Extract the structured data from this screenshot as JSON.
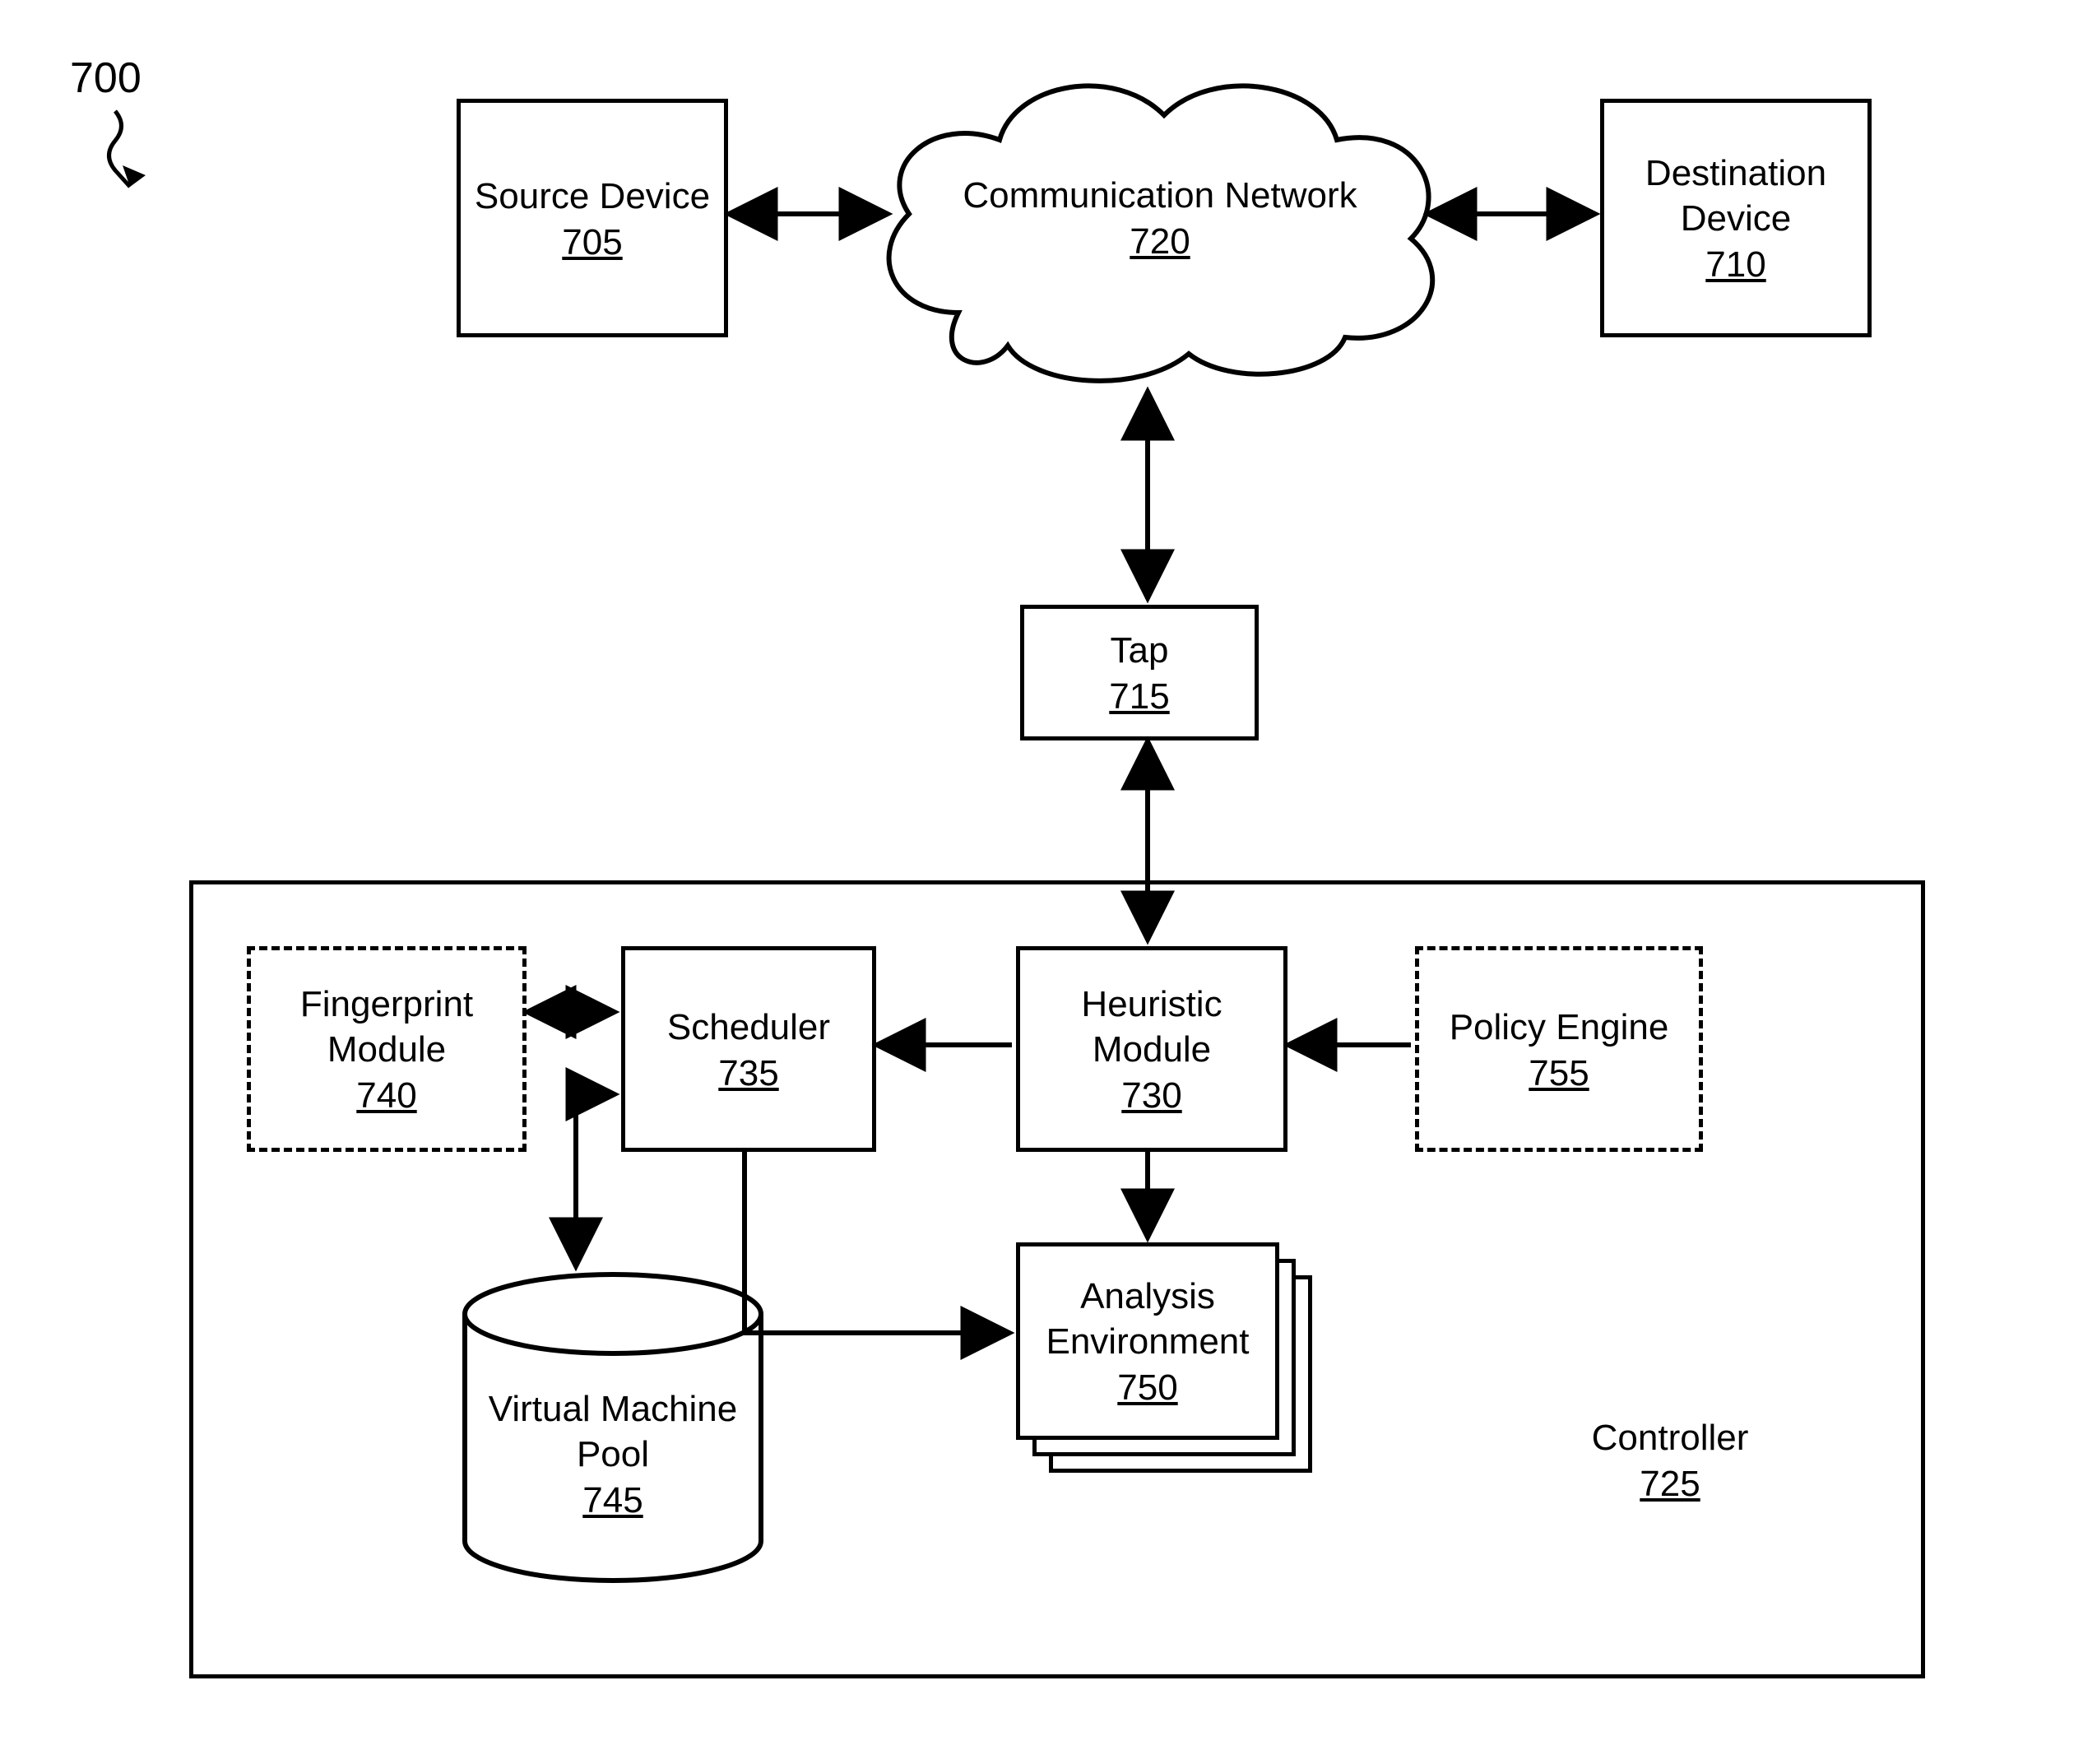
{
  "figure_ref": "700",
  "nodes": {
    "source": {
      "label": "Source Device",
      "num": "705"
    },
    "destination": {
      "label": "Destination Device",
      "num": "710"
    },
    "tap": {
      "label": "Tap",
      "num": "715"
    },
    "network": {
      "label": "Communication Network",
      "num": "720"
    },
    "controller": {
      "label": "Controller",
      "num": "725"
    },
    "heuristic": {
      "label": "Heuristic Module",
      "num": "730"
    },
    "scheduler": {
      "label": "Scheduler",
      "num": "735"
    },
    "fingerprint": {
      "label": "Fingerprint Module",
      "num": "740"
    },
    "vmpool": {
      "label": "Virtual Machine Pool",
      "num": "745"
    },
    "analysis": {
      "label": "Analysis Environment",
      "num": "750"
    },
    "policy": {
      "label": "Policy Engine",
      "num": "755"
    }
  },
  "edges": [
    {
      "from": "source",
      "to": "network",
      "bidir": true
    },
    {
      "from": "network",
      "to": "destination",
      "bidir": true
    },
    {
      "from": "network",
      "to": "tap",
      "bidir": true
    },
    {
      "from": "tap",
      "to": "heuristic",
      "bidir": true
    },
    {
      "from": "heuristic",
      "to": "scheduler",
      "bidir": false
    },
    {
      "from": "policy",
      "to": "heuristic",
      "bidir": false
    },
    {
      "from": "fingerprint",
      "to": "scheduler",
      "bidir": true
    },
    {
      "from": "heuristic",
      "to": "analysis",
      "bidir": false
    },
    {
      "from": "scheduler",
      "to": "analysis",
      "bidir": false
    },
    {
      "from": "scheduler",
      "to": "vmpool",
      "bidir": true
    }
  ]
}
